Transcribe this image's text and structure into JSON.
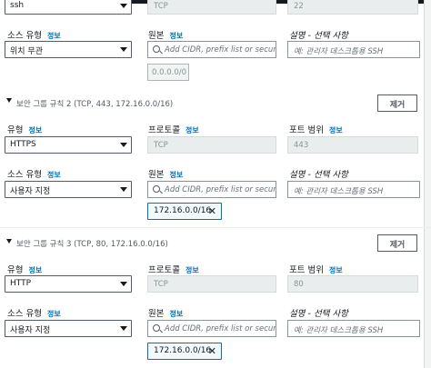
{
  "top_partial": {
    "type_value": "ssh",
    "protocol_value": "TCP",
    "port_value": "22"
  },
  "rule1": {
    "source_type_label": "소스 유형",
    "info": "정보",
    "source_type_value": "위치 무관",
    "source_label": "원본",
    "source_placeholder": "Add CIDR, prefix list or security",
    "desc_label": "설명 - 선택 사항",
    "desc_placeholder": "예: 관리자 데스크톱용 SSH",
    "token_value": "0.0.0.0/0"
  },
  "rule2": {
    "title": "보안 그룹 규칙 2 (TCP, 443, 172.16.0.0/16)",
    "remove_button": "제거",
    "type_label": "유형",
    "info": "정보",
    "type_value": "HTTPS",
    "protocol_label": "프로토콜",
    "protocol_value": "TCP",
    "port_label": "포트 범위",
    "port_value": "443",
    "source_type_label": "소스 유형",
    "source_type_value": "사용자 지정",
    "source_label": "원본",
    "source_placeholder": "Add CIDR, prefix list or security",
    "desc_label": "설명 - 선택 사항",
    "desc_placeholder": "예: 관리자 데스크톱용 SSH",
    "token_value": "172.16.0.0/16"
  },
  "rule3": {
    "title": "보안 그룹 규칙 3 (TCP, 80, 172.16.0.0/16)",
    "remove_button": "제거",
    "type_label": "유형",
    "info": "정보",
    "type_value": "HTTP",
    "protocol_label": "프로토콜",
    "protocol_value": "TCP",
    "port_label": "포트 범위",
    "port_value": "80",
    "source_type_label": "소스 유형",
    "source_type_value": "사용자 지정",
    "source_label": "원본",
    "source_placeholder": "Add CIDR, prefix list or security",
    "desc_label": "설명 - 선택 사항",
    "desc_placeholder": "예: 관리자 데스크톱용 SSH",
    "token_value": "172.16.0.0/16"
  }
}
